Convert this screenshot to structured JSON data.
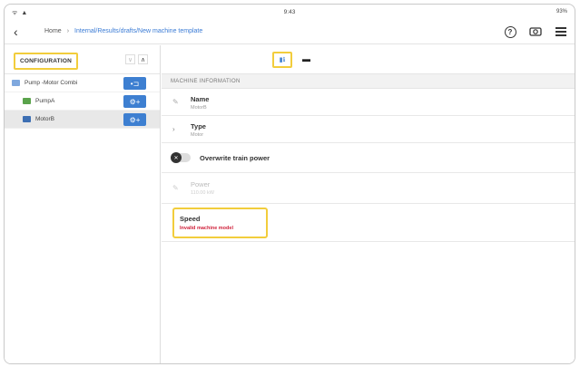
{
  "statusbar": {
    "signal": "ᯤ ▲",
    "time": "9:43",
    "battery": "93%"
  },
  "topbar": {
    "back_glyph": "‹",
    "home": "Home",
    "separator": "›",
    "path": "Internal/Results/drafts/New machine template",
    "icons": [
      "help-icon",
      "camera-record-icon",
      "menu-icon"
    ]
  },
  "left_panel": {
    "title": "CONFIGURATION",
    "collapse_down": "∨",
    "collapse_up": "∧",
    "tree": [
      {
        "label": "Pump -Motor Combi",
        "icon": "train-icon",
        "button_glyph": "•⊐"
      },
      {
        "label": "PumpA",
        "icon": "pump-icon",
        "button_glyph": "⚙+"
      },
      {
        "label": "MotorB",
        "icon": "motor-icon",
        "button_glyph": "⚙+"
      }
    ]
  },
  "right_panel": {
    "tab_info": "▮ℹ",
    "tab_comment": "▬",
    "section": "MACHINE INFORMATION",
    "name": {
      "title": "Name",
      "value": "MotorB"
    },
    "type": {
      "title": "Type",
      "value": "Motor"
    },
    "overwrite": {
      "title": "Overwrite train power",
      "knob": "✕"
    },
    "power": {
      "title": "Power",
      "value": "110.00 kW"
    },
    "speed": {
      "title": "Speed",
      "error": "Invalid machine model"
    }
  },
  "colors": {
    "accent": "#3d7fd1",
    "highlight": "#f2cd3c",
    "error": "#d0233c"
  }
}
